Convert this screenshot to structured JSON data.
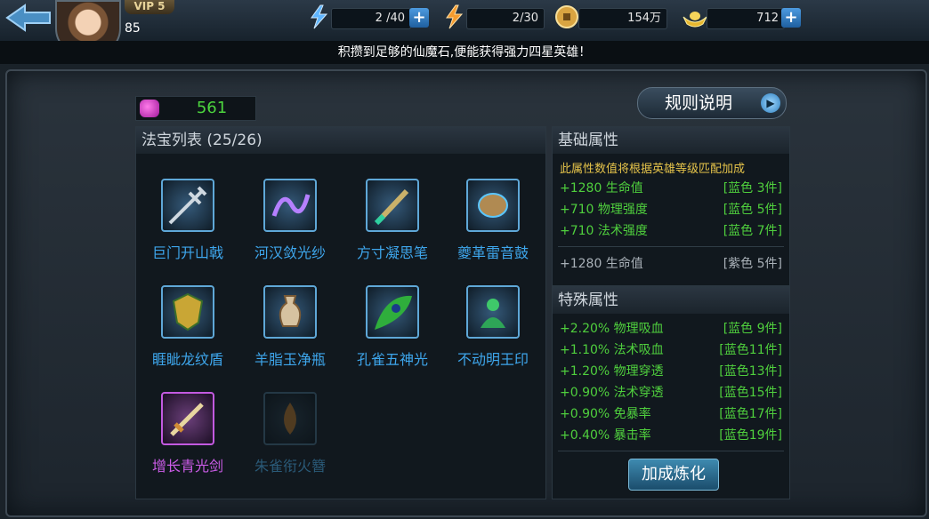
{
  "player": {
    "vip": "VIP 5",
    "level": "85"
  },
  "resources": {
    "stamina": {
      "icon": "lightning-icon",
      "value": "2 /40"
    },
    "vitality": {
      "icon": "energy-icon",
      "value": "2/30"
    },
    "coins": {
      "icon": "coin-icon",
      "value": "154万"
    },
    "gold": {
      "icon": "gold-ingot-icon",
      "value": "712"
    }
  },
  "marquee": "积攒到足够的仙魔石,便能获得强力四星英雄！",
  "gem_count": "561",
  "rules_button": "规则说明",
  "treasure_list": {
    "title": "法宝列表 (25/26)",
    "items": [
      {
        "name": "巨门开山戟",
        "icon": "halberd-icon",
        "tier": "blue"
      },
      {
        "name": "河汉敛光纱",
        "icon": "gauze-icon",
        "tier": "blue"
      },
      {
        "name": "方寸凝思笔",
        "icon": "brush-icon",
        "tier": "blue"
      },
      {
        "name": "夔革雷音鼓",
        "icon": "drum-icon",
        "tier": "blue"
      },
      {
        "name": "睚眦龙纹盾",
        "icon": "dragon-shield-icon",
        "tier": "blue"
      },
      {
        "name": "羊脂玉净瓶",
        "icon": "jade-vase-icon",
        "tier": "blue"
      },
      {
        "name": "孔雀五神光",
        "icon": "peacock-feather-icon",
        "tier": "blue"
      },
      {
        "name": "不动明王印",
        "icon": "buddha-seal-icon",
        "tier": "blue"
      },
      {
        "name": "增长青光剑",
        "icon": "sword-icon",
        "tier": "purple"
      },
      {
        "name": "朱雀衔火簪",
        "icon": "hairpin-icon",
        "tier": "locked"
      }
    ]
  },
  "basic_attributes": {
    "title": "基础属性",
    "note": "此属性数值将根据英雄等级匹配加成",
    "rows": [
      {
        "value": "+1280 生命值",
        "cond": "[蓝色 3件]",
        "active": true
      },
      {
        "value": "+710 物理强度",
        "cond": "[蓝色 5件]",
        "active": true
      },
      {
        "value": "+710 法术强度",
        "cond": "[蓝色 7件]",
        "active": true
      },
      {
        "value": "+1280 生命值",
        "cond": "[紫色 5件]",
        "active": false
      }
    ]
  },
  "special_attributes": {
    "title": "特殊属性",
    "rows": [
      {
        "value": "+2.20% 物理吸血",
        "cond": "[蓝色 9件]"
      },
      {
        "value": "+1.10% 法术吸血",
        "cond": "[蓝色11件]"
      },
      {
        "value": "+1.20% 物理穿透",
        "cond": "[蓝色13件]"
      },
      {
        "value": "+0.90% 法术穿透",
        "cond": "[蓝色15件]"
      },
      {
        "value": "+0.90% 免暴率",
        "cond": "[蓝色17件]"
      },
      {
        "value": "+0.40% 暴击率",
        "cond": "[蓝色19件]"
      }
    ]
  },
  "refine_button": "加成炼化"
}
